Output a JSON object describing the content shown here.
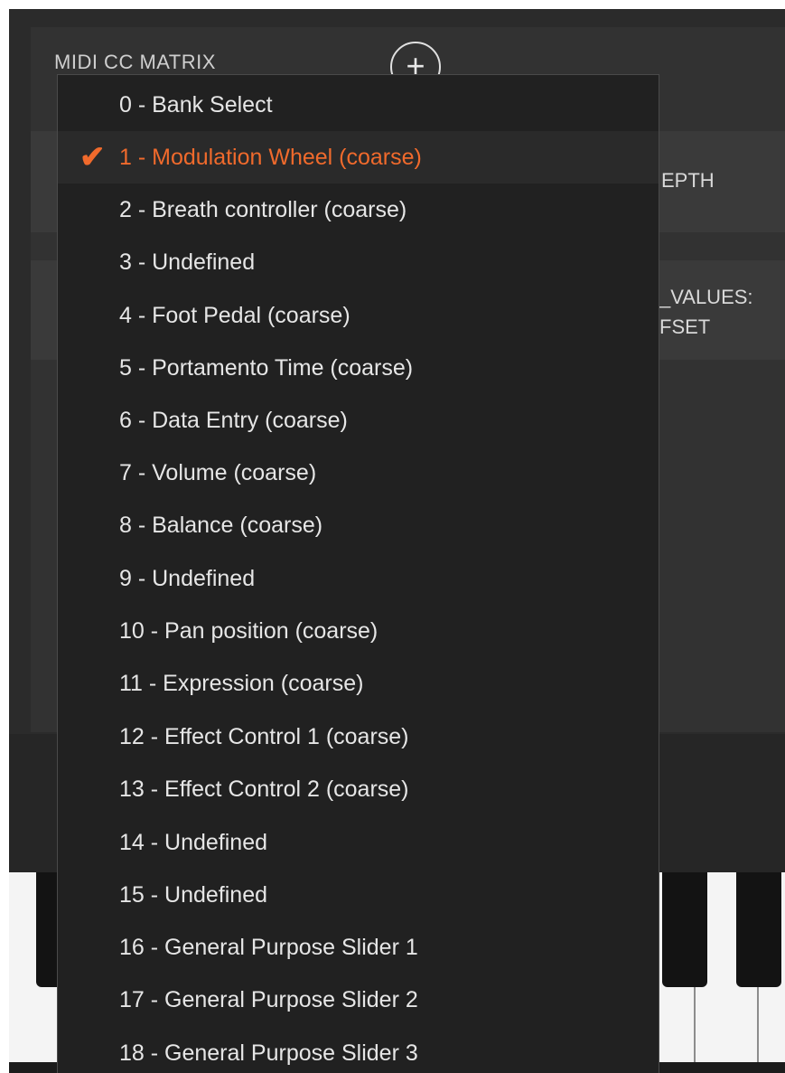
{
  "header": {
    "title": "MIDI CC MATRIX",
    "add_label": "+"
  },
  "background": {
    "depth_label": "EPTH",
    "values_label": "_VALUES:",
    "offset_label": "FSET"
  },
  "dropdown": {
    "selected_index": 1,
    "items": [
      "0 - Bank Select",
      "1 - Modulation Wheel (coarse)",
      "2 - Breath controller (coarse)",
      "3 - Undefined",
      "4 - Foot Pedal (coarse)",
      "5 - Portamento Time (coarse)",
      "6 - Data Entry (coarse)",
      "7 - Volume (coarse)",
      "8 - Balance (coarse)",
      "9 - Undefined",
      "10 - Pan position (coarse)",
      "11 - Expression (coarse)",
      "12 - Effect Control 1 (coarse)",
      "13 - Effect Control 2 (coarse)",
      "14 - Undefined",
      "15 - Undefined",
      "16 - General Purpose Slider 1",
      "17 - General Purpose Slider 2",
      "18 - General Purpose Slider 3"
    ]
  },
  "colors": {
    "accent": "#f06a2c",
    "menu_bg": "#212121",
    "app_bg": "#2b2b2b"
  }
}
